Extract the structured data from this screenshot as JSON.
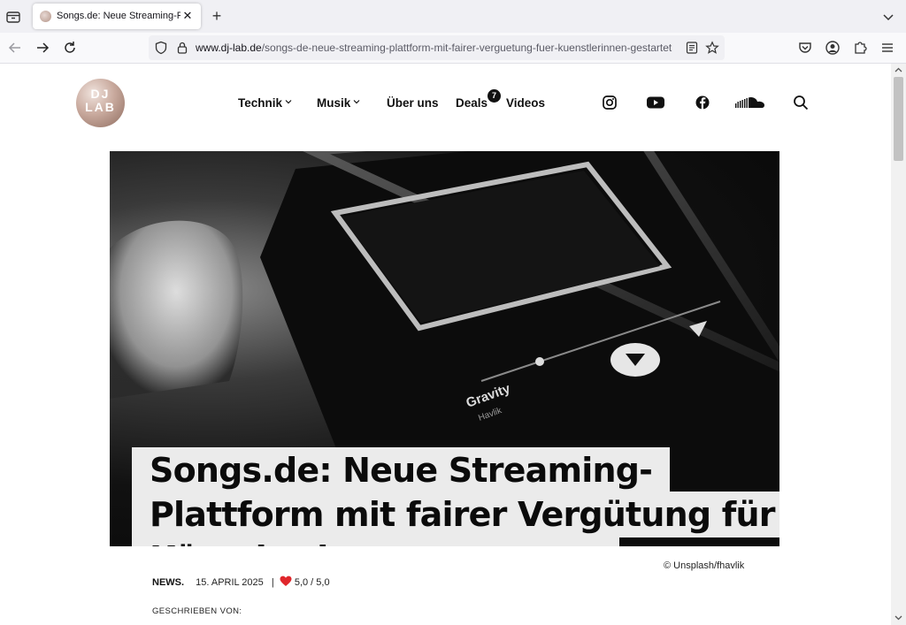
{
  "browser": {
    "tab_title": "Songs.de: Neue Streaming-Platt",
    "url_domain": "www.dj-lab.de",
    "url_path": "/songs-de-neue-streaming-plattform-mit-fairer-verguetung-fuer-kuenstlerinnen-gestartet"
  },
  "site": {
    "logo_text_1": "DJ",
    "logo_text_2": "LAB",
    "menu": {
      "technik": "Technik",
      "musik": "Musik",
      "ueber_uns": "Über uns",
      "deals": "Deals",
      "deals_badge": "7",
      "videos": "Videos"
    },
    "social_icons": [
      "instagram-icon",
      "youtube-icon",
      "facebook-icon",
      "soundcloud-icon",
      "search-icon"
    ]
  },
  "article": {
    "title_lines": [
      "Songs.de: Neue Streaming-",
      "Plattform mit fairer Vergütung für",
      "Künstler:innen gestartet"
    ],
    "image_credit": "© Unsplash/fhavlik",
    "hero_screen_title": "Gravity",
    "hero_screen_artist": "Havlik",
    "category": "NEWS.",
    "date": "15. APRIL 2025",
    "separator": "|",
    "rating": "5,0 / 5,0",
    "written_by": "GESCHRIEBEN VON:"
  },
  "colors": {
    "heart": "#e0262b",
    "title_bg": "#ebebeb"
  }
}
